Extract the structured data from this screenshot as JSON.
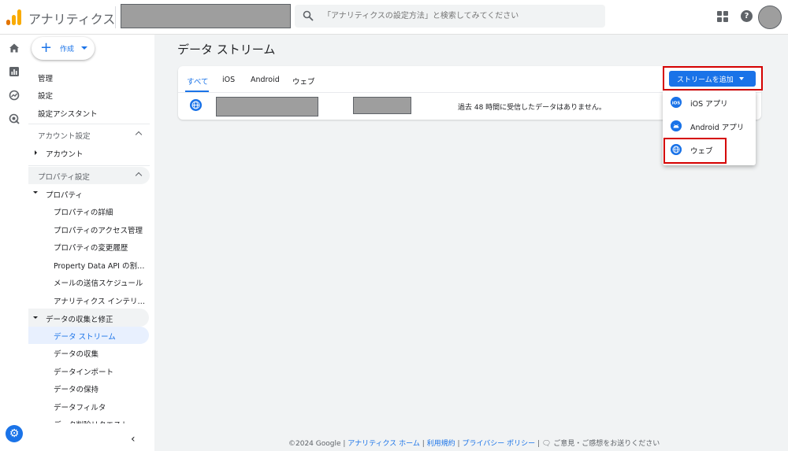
{
  "app": {
    "title": "アナリティクス"
  },
  "search": {
    "placeholder": "「アナリティクスの設定方法」と検索してみてください"
  },
  "nav": {
    "create_label": "作成",
    "top_items": [
      "管理",
      "設定",
      "設定アシスタント"
    ],
    "account_section": {
      "title": "アカウント設定",
      "items": [
        "アカウント"
      ]
    },
    "property_section": {
      "title": "プロパティ設定",
      "group": "プロパティ",
      "subitems": [
        "プロパティの詳細",
        "プロパティのアクセス管理",
        "プロパティの変更履歴",
        "Property Data API の割り当て",
        "メールの送信スケジュール",
        "アナリティクス インテリジェンス"
      ],
      "data_group": "データの収集と修正",
      "data_items": [
        "データ ストリーム",
        "データの収集",
        "データインポート",
        "データの保持",
        "データフィルタ",
        "データ削除リクエスト"
      ]
    }
  },
  "main": {
    "title": "データ ストリーム",
    "tabs": [
      "すべて",
      "iOS",
      "Android",
      "ウェブ"
    ],
    "active_tab": "すべて",
    "stream_row": {
      "status": "過去 48 時間に受信したデータはありません。"
    },
    "add_stream_button": "ストリームを追加",
    "menu": [
      "iOS アプリ",
      "Android アプリ",
      "ウェブ"
    ]
  },
  "footer": {
    "copyright": "©2024 Google",
    "links": [
      "アナリティクス ホーム",
      "利用規約",
      "プライバシー ポリシー"
    ],
    "feedback": "ご意見・ご感想をお送りください"
  },
  "colors": {
    "accent": "#1a73e8",
    "highlight": "#d50000"
  },
  "icons": [
    "analytics-logo-icon",
    "search-icon",
    "apps-grid-icon",
    "help-icon",
    "home-icon",
    "reports-icon",
    "explore-icon",
    "advertising-icon",
    "settings-gear-icon",
    "globe-icon",
    "ios-icon",
    "android-icon",
    "feedback-icon",
    "chevron-left-icon"
  ]
}
